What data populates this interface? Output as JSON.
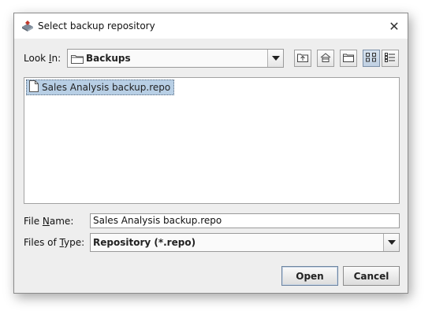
{
  "window": {
    "title": "Select backup repository",
    "close_glyph": "✕"
  },
  "look_in": {
    "label_prefix": "Look ",
    "label_mnemonic": "I",
    "label_suffix": "n:",
    "value": "Backups"
  },
  "toolbar": {
    "buttons": [
      {
        "name": "up-one-level-icon"
      },
      {
        "name": "home-icon"
      },
      {
        "name": "new-folder-icon"
      },
      {
        "name": "list-view-icon",
        "active": true
      },
      {
        "name": "details-view-icon"
      }
    ]
  },
  "files": [
    {
      "name": "Sales Analysis backup.repo",
      "selected": true
    }
  ],
  "file_name": {
    "label_prefix": "File ",
    "label_mnemonic": "N",
    "label_suffix": "ame:",
    "value": "Sales Analysis backup.repo"
  },
  "files_of_type": {
    "label_prefix": "Files of ",
    "label_mnemonic": "T",
    "label_suffix": "ype:",
    "value": "Repository (*.repo)"
  },
  "buttons": {
    "open": "Open",
    "cancel": "Cancel"
  },
  "colors": {
    "selection": "#b8cfe5",
    "dialog_bg": "#eeeeee"
  }
}
